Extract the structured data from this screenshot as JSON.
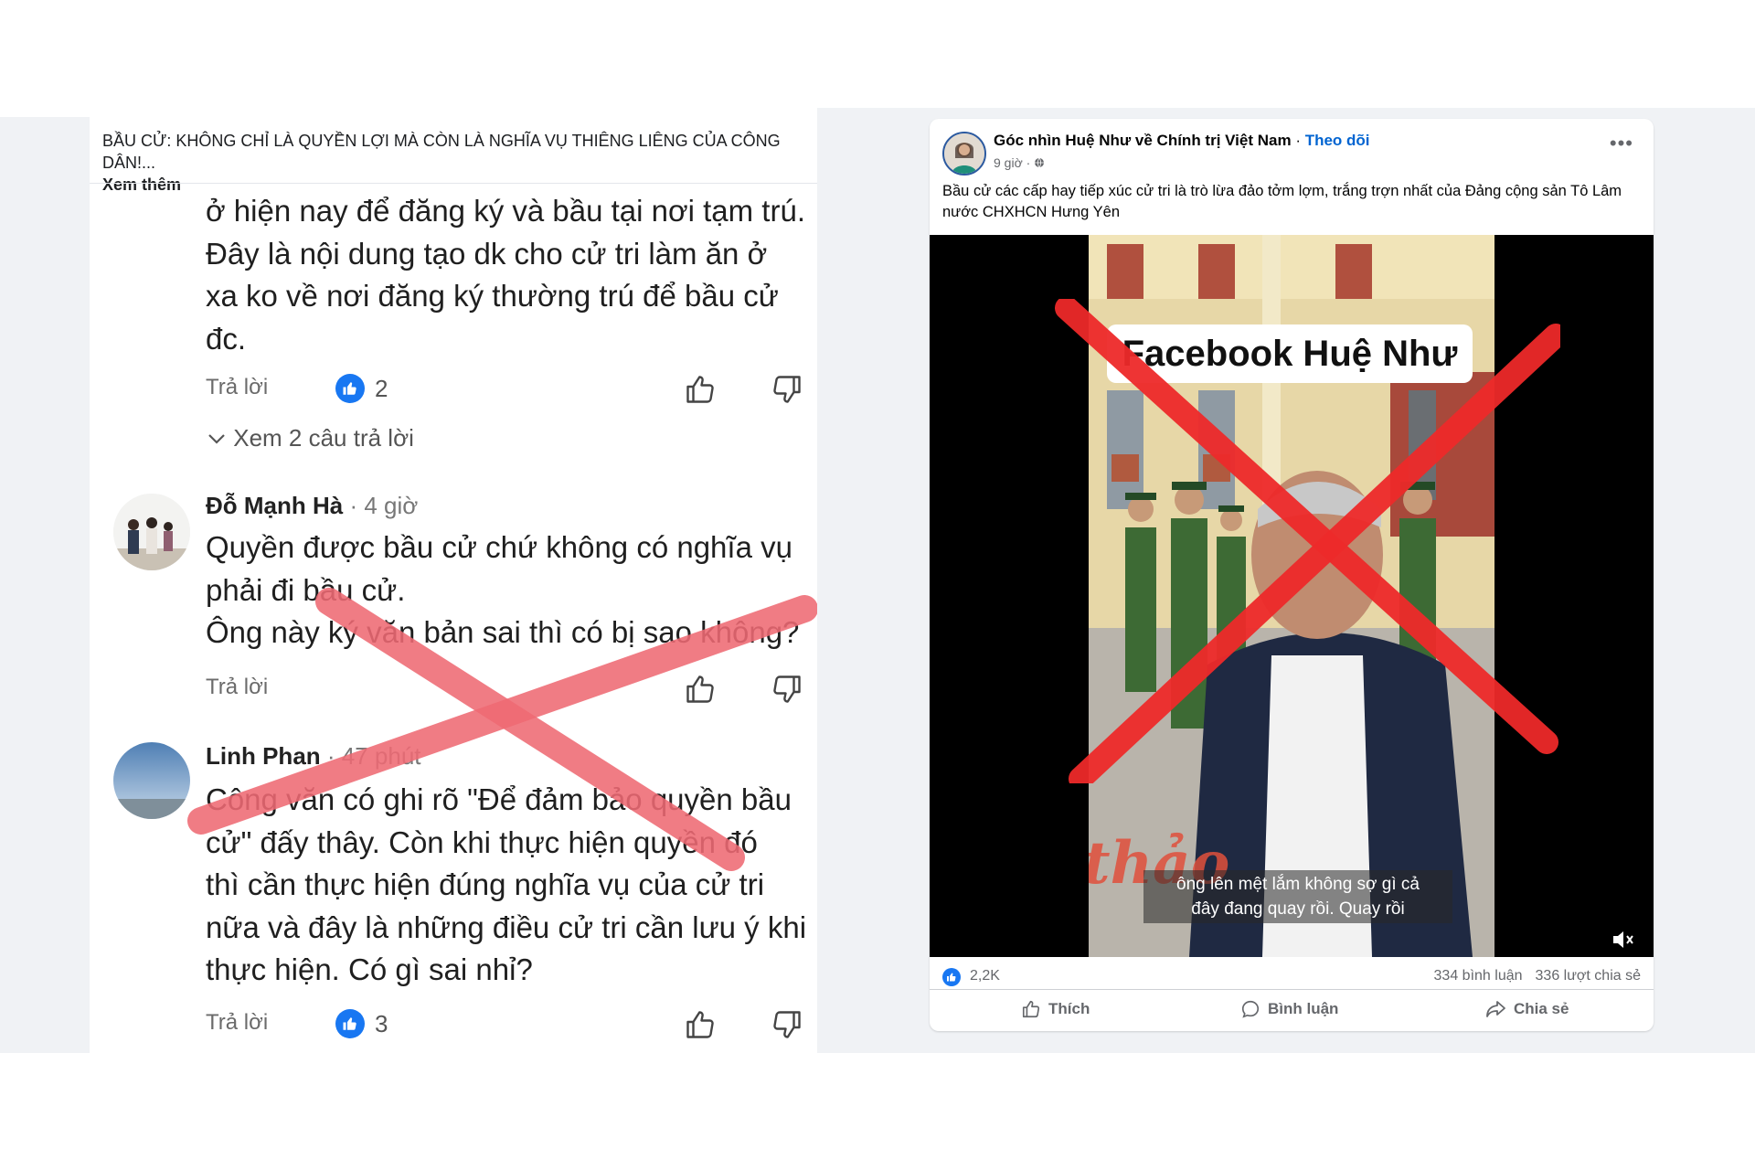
{
  "left_panel": {
    "header": {
      "title": "BẦU CỬ: KHÔNG CHỈ LÀ QUYỀN LỢI MÀ CÒN LÀ NGHĨA VỤ THIÊNG LIÊNG CỦA CÔNG DÂN!...",
      "see_more": "Xem thêm"
    },
    "comment1": {
      "text": "ở hiện nay để đăng ký và bầu tại nơi tạm trú.\nĐây là nội dung tạo dk cho cử tri làm ăn ở\nxa ko về nơi đăng ký thường trú để bầu cử\nđc.",
      "reply": "Trả lời",
      "likes": "2",
      "more_replies": "Xem 2 câu trả lời"
    },
    "comment2": {
      "author": "Đỗ Mạnh Hà",
      "time": "· 4 giờ",
      "text": "Quyền được bầu cử chứ không có nghĩa vụ\nphải đi bầu cử.\nÔng này ký văn bản sai thì có bị sao không?",
      "reply": "Trả lời"
    },
    "comment3": {
      "author": "Linh Phan",
      "time": "· 47 phút",
      "text": "Công văn có ghi rõ \"Để đảm bảo quyền bầu\ncử\"  đấy thây. Còn khi thực hiện quyền đó\nthì cần thực hiện đúng nghĩa vụ của cử tri\nnữa và đây là những điều cử tri cần lưu ý khi\nthực hiện. Có gì sai nhỉ?",
      "reply": "Trả lời",
      "likes": "3"
    }
  },
  "post": {
    "page_name": "Góc nhìn Huệ Như về Chính trị Việt Nam",
    "separator": " · ",
    "follow": "Theo dõi",
    "time": "9 giờ ·",
    "text": "Bầu cử các cấp hay tiếp xúc cử tri là trò lừa đảo tởm lợm, trắng trợn nhất của Đảng cộng sản Tô Lâm nước CHXHCN Hưng Yên",
    "video": {
      "label": "Facebook Huệ Như",
      "subtitle": "ông lên mệt lắm không sợ gì cả\nđây đang quay rồi. Quay rồi",
      "stamp": "thảo"
    },
    "stats": {
      "likes": "2,2K",
      "comments": "334 bình luận",
      "shares": "336 lượt chia sẻ"
    },
    "actions": {
      "like": "Thích",
      "comment": "Bình luận",
      "share": "Chia sẻ"
    }
  },
  "colors": {
    "facebook_blue": "#1877f2",
    "strike_red": "#ee2a2a",
    "strike_pink": "#ef6a74"
  }
}
